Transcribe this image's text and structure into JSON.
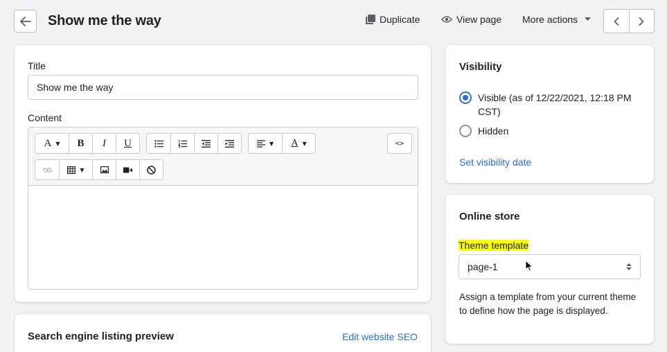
{
  "header": {
    "title": "Show me the way",
    "duplicate_label": "Duplicate",
    "view_page_label": "View page",
    "more_actions_label": "More actions"
  },
  "main": {
    "title_label": "Title",
    "title_value": "Show me the way",
    "content_label": "Content",
    "toolbar": {
      "font_glyph": "A",
      "bold_glyph": "B",
      "italic_glyph": "I",
      "underline_glyph": "U",
      "color_glyph": "A",
      "html_glyph": "<>"
    }
  },
  "seo": {
    "title": "Search engine listing preview",
    "edit_link": "Edit website SEO"
  },
  "visibility": {
    "title": "Visibility",
    "options": [
      {
        "label": "Visible (as of 12/22/2021, 12:18 PM CST)",
        "checked": true
      },
      {
        "label": "Hidden",
        "checked": false
      }
    ],
    "set_date_link": "Set visibility date"
  },
  "online_store": {
    "title": "Online store",
    "theme_template_label": "Theme template",
    "template_value": "page-1",
    "help_text": "Assign a template from your current theme to define how the page is displayed."
  },
  "colors": {
    "accent": "#2c6ecb",
    "highlight": "#ffff00",
    "background": "#f1f2f3"
  },
  "icons": [
    "arrow-left-icon",
    "duplicate-icon",
    "eye-icon",
    "caret-down-icon",
    "chevron-left-icon",
    "chevron-right-icon",
    "bullet-list-icon",
    "numbered-list-icon",
    "outdent-icon",
    "indent-icon",
    "align-left-icon",
    "link-icon",
    "table-icon",
    "image-icon",
    "video-icon",
    "block-icon",
    "select-arrows-icon",
    "mouse-cursor-icon"
  ]
}
